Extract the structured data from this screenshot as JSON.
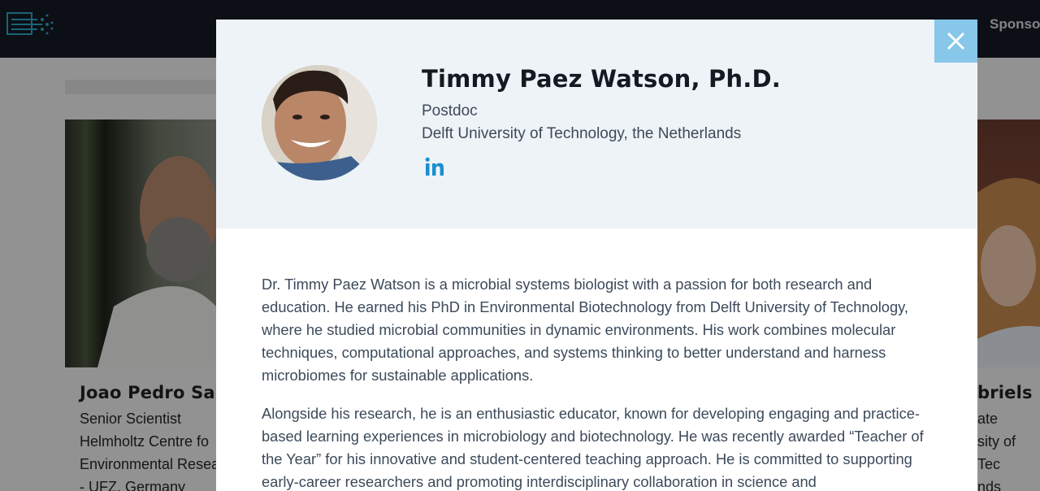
{
  "header": {
    "nav_right": "Sponso"
  },
  "background_cards": {
    "left": {
      "name": "Joao Pedro Sara",
      "lines": [
        "Senior Scientist",
        "Helmholtz Centre fo",
        "Environmental Resea",
        "- UFZ, Germany"
      ]
    },
    "right": {
      "name": "briels",
      "lines": [
        "ate",
        "sity of Tec",
        "nds"
      ]
    }
  },
  "modal": {
    "name": "Timmy Paez Watson, Ph.D.",
    "role": "Postdoc",
    "affiliation": "Delft University of Technology, the Netherlands",
    "social_icon": "linkedin-icon",
    "close_icon": "close-icon",
    "bio": [
      "Dr. Timmy Paez Watson is a microbial systems biologist with a passion for both research and education. He earned his PhD in Environmental Biotechnology from Delft University of Technology, where he studied microbial communities in dynamic environments. His work combines molecular techniques, computational approaches, and systems thinking to better understand and harness microbiomes for sustainable applications.",
      "Alongside his research, he is an enthusiastic educator, known for developing engaging and practice-based learning experiences in microbiology and biotechnology. He was recently awarded “Teacher of the Year” for his innovative and student-centered teaching approach. He is committed to supporting early-career researchers and promoting interdisciplinary collaboration in science and"
    ]
  },
  "colors": {
    "topbar": "#151a24",
    "modal_header_bg": "#eef3f8",
    "close_button": "#87c7ea",
    "linkedin": "#1a8fcf"
  }
}
